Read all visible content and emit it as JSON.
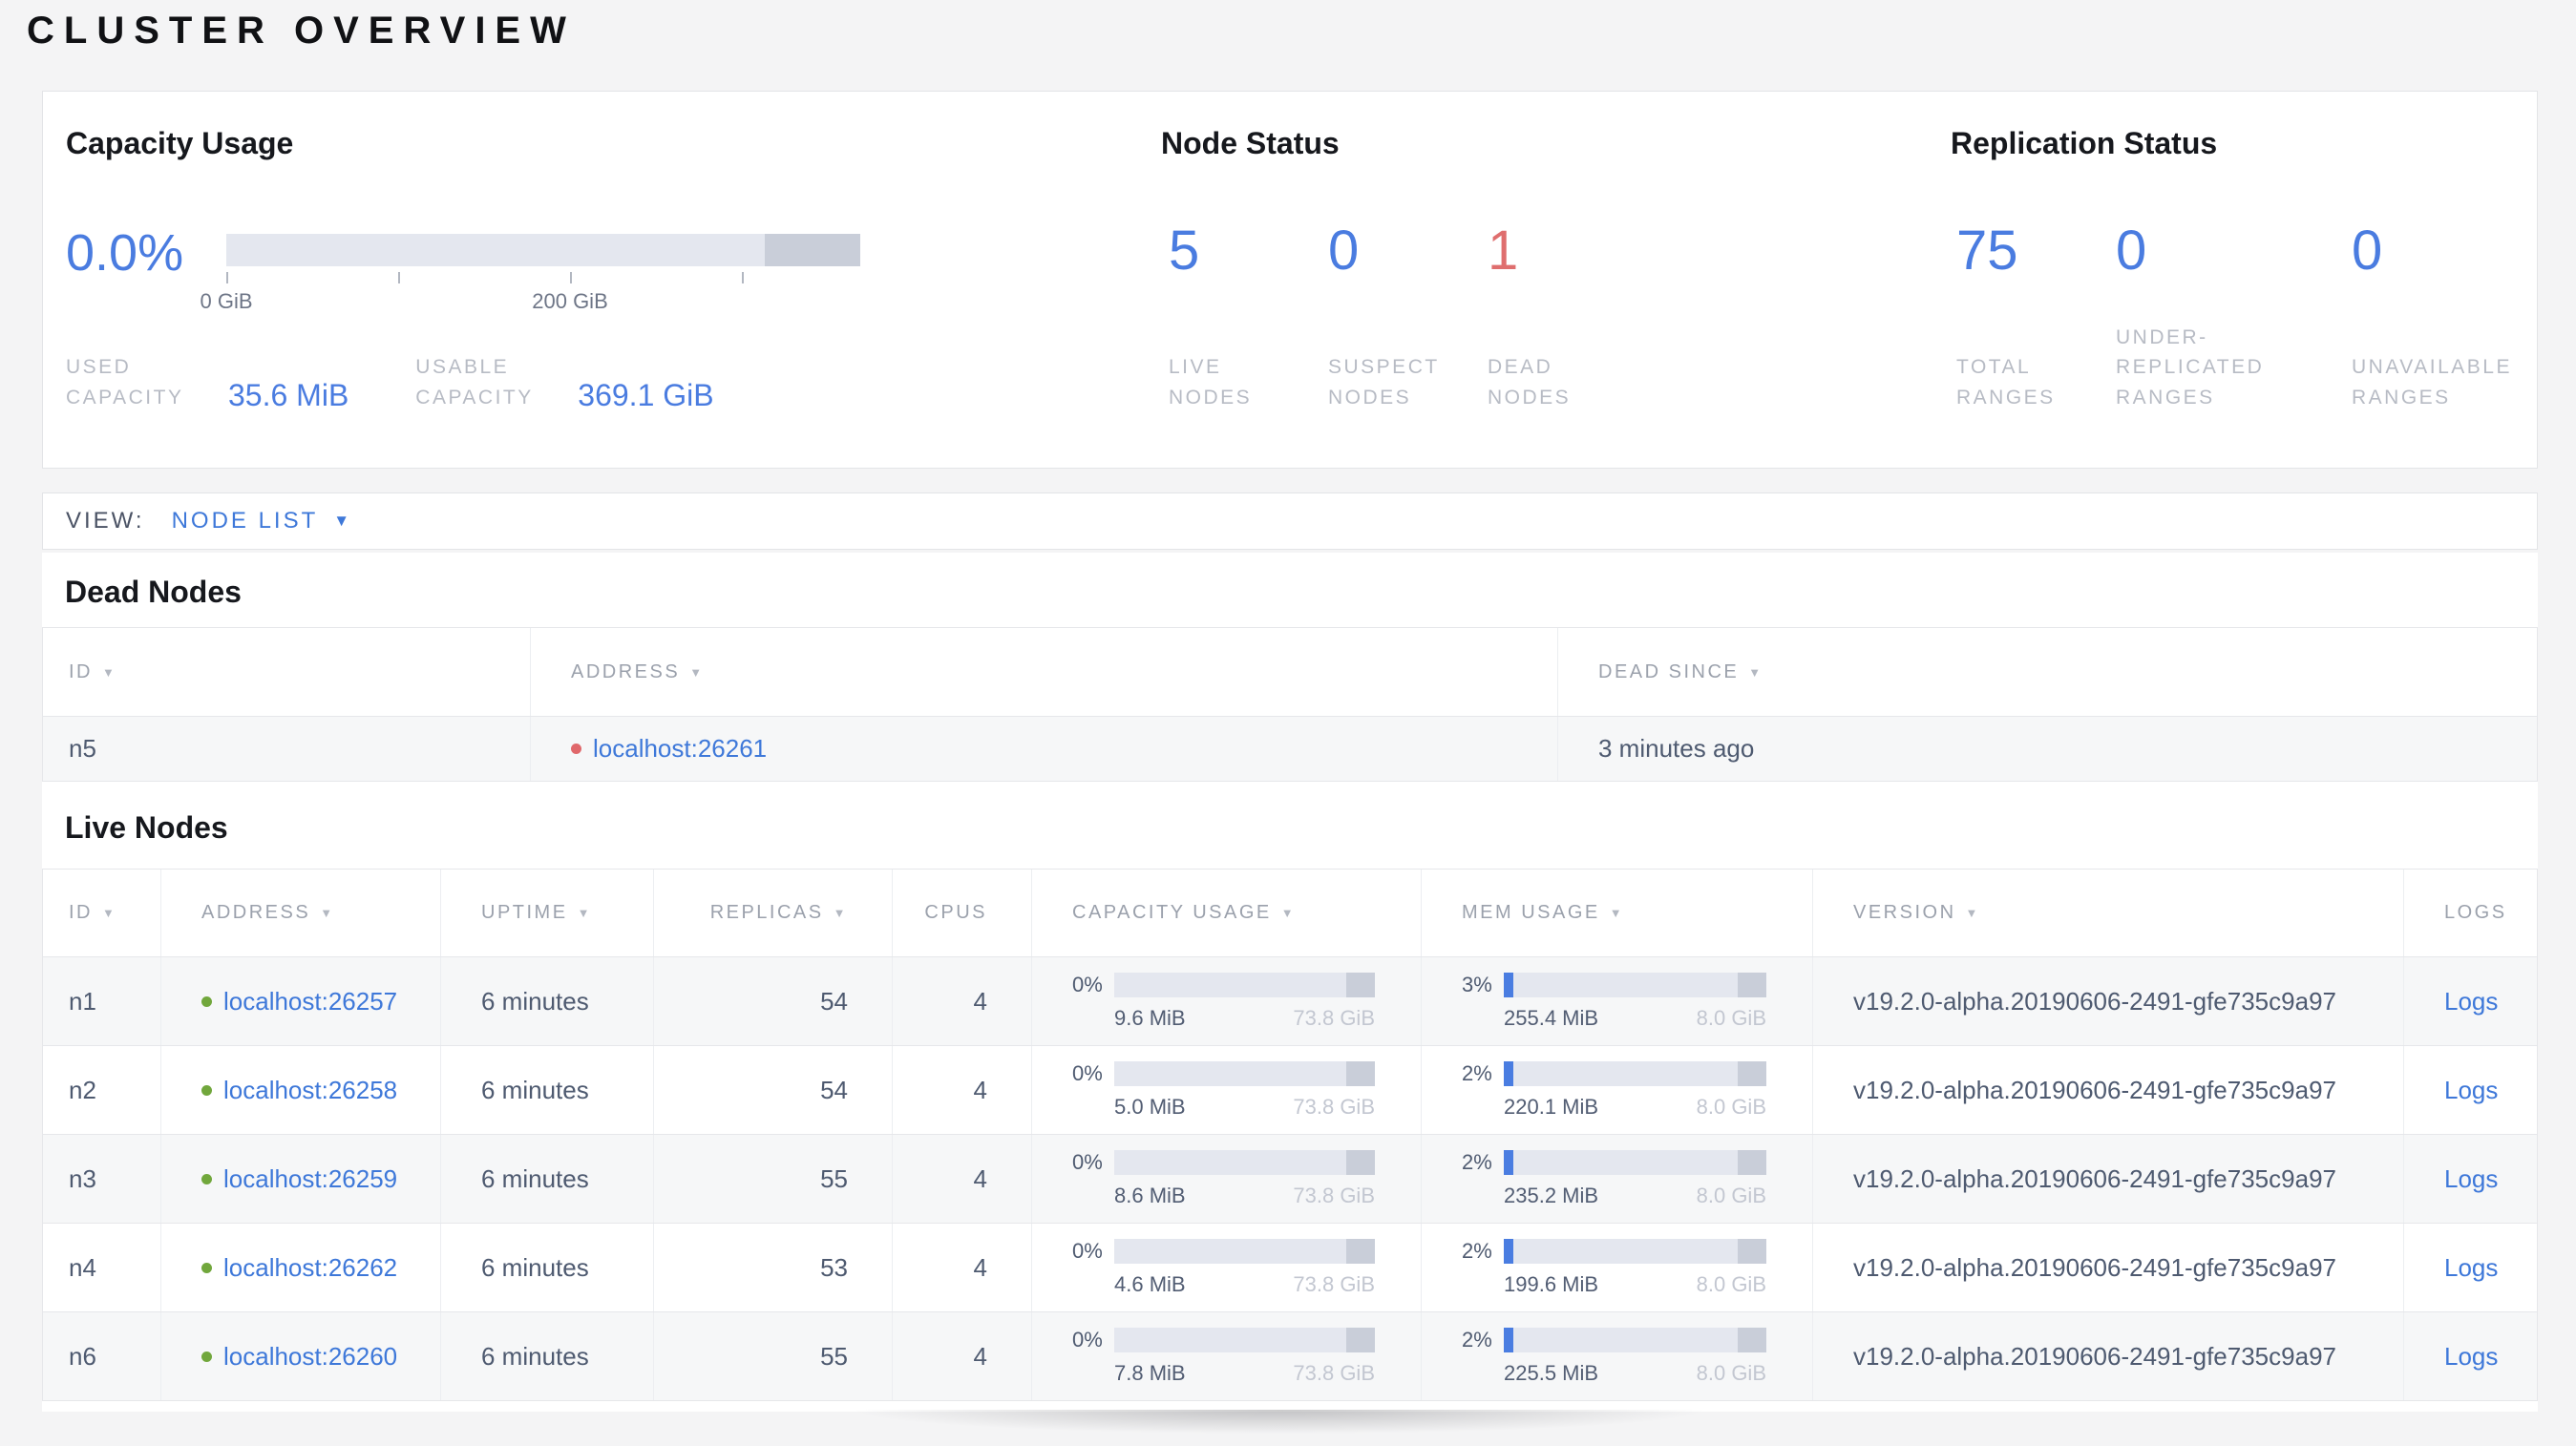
{
  "page": {
    "title": "CLUSTER OVERVIEW"
  },
  "icons": {
    "sort_arrow": "▼",
    "dropdown_caret": "▼"
  },
  "colors": {
    "accent_blue": "#4a7ce0",
    "link_blue": "#3e78d9",
    "danger_red": "#df6e6e",
    "live_dot_green": "#71a73c",
    "dead_dot_red": "#e0686b",
    "bar_light": "#e4e7ef",
    "bar_dark": "#c9ced9",
    "mem_used_blue": "#4a7de1"
  },
  "summary": {
    "capacity": {
      "title": "Capacity Usage",
      "percent": "0.0%",
      "axis_tick_labels": [
        "0 GiB",
        "200 GiB"
      ],
      "stats": [
        {
          "label": "USED CAPACITY",
          "value": "35.6 MiB"
        },
        {
          "label": "USABLE CAPACITY",
          "value": "369.1 GiB"
        }
      ]
    },
    "node_status": {
      "title": "Node Status",
      "stats": [
        {
          "value": "5",
          "label": "LIVE NODES"
        },
        {
          "value": "0",
          "label": "SUSPECT NODES"
        },
        {
          "value": "1",
          "label": "DEAD NODES"
        }
      ]
    },
    "replication": {
      "title": "Replication Status",
      "stats": [
        {
          "value": "75",
          "label": "TOTAL RANGES"
        },
        {
          "value": "0",
          "label": "UNDER-REPLICATED RANGES"
        },
        {
          "value": "0",
          "label": "UNAVAILABLE RANGES"
        }
      ]
    }
  },
  "view_bar": {
    "label": "VIEW:",
    "selected": "NODE LIST"
  },
  "dead_nodes": {
    "title": "Dead Nodes",
    "columns": [
      {
        "label": "ID"
      },
      {
        "label": "ADDRESS"
      },
      {
        "label": "DEAD SINCE"
      }
    ],
    "rows": [
      {
        "id": "n5",
        "address": "localhost:26261",
        "dead_since": "3 minutes ago"
      }
    ]
  },
  "live_nodes": {
    "title": "Live Nodes",
    "columns": [
      {
        "label": "ID"
      },
      {
        "label": "ADDRESS"
      },
      {
        "label": "UPTIME"
      },
      {
        "label": "REPLICAS"
      },
      {
        "label": "CPUS"
      },
      {
        "label": "CAPACITY USAGE"
      },
      {
        "label": "MEM USAGE"
      },
      {
        "label": "VERSION"
      },
      {
        "label": "LOGS"
      }
    ],
    "rows": [
      {
        "id": "n1",
        "address": "localhost:26257",
        "uptime": "6 minutes",
        "replicas": "54",
        "cpus": "4",
        "capacity": {
          "pct": "0%",
          "pct_num": 0,
          "used": "9.6 MiB",
          "total": "73.8 GiB"
        },
        "mem": {
          "pct": "3%",
          "pct_num": 3,
          "used": "255.4 MiB",
          "total": "8.0 GiB"
        },
        "version": "v19.2.0-alpha.20190606-2491-gfe735c9a97",
        "logs_label": "Logs"
      },
      {
        "id": "n2",
        "address": "localhost:26258",
        "uptime": "6 minutes",
        "replicas": "54",
        "cpus": "4",
        "capacity": {
          "pct": "0%",
          "pct_num": 0,
          "used": "5.0 MiB",
          "total": "73.8 GiB"
        },
        "mem": {
          "pct": "2%",
          "pct_num": 2,
          "used": "220.1 MiB",
          "total": "8.0 GiB"
        },
        "version": "v19.2.0-alpha.20190606-2491-gfe735c9a97",
        "logs_label": "Logs"
      },
      {
        "id": "n3",
        "address": "localhost:26259",
        "uptime": "6 minutes",
        "replicas": "55",
        "cpus": "4",
        "capacity": {
          "pct": "0%",
          "pct_num": 0,
          "used": "8.6 MiB",
          "total": "73.8 GiB"
        },
        "mem": {
          "pct": "2%",
          "pct_num": 2,
          "used": "235.2 MiB",
          "total": "8.0 GiB"
        },
        "version": "v19.2.0-alpha.20190606-2491-gfe735c9a97",
        "logs_label": "Logs"
      },
      {
        "id": "n4",
        "address": "localhost:26262",
        "uptime": "6 minutes",
        "replicas": "53",
        "cpus": "4",
        "capacity": {
          "pct": "0%",
          "pct_num": 0,
          "used": "4.6 MiB",
          "total": "73.8 GiB"
        },
        "mem": {
          "pct": "2%",
          "pct_num": 2,
          "used": "199.6 MiB",
          "total": "8.0 GiB"
        },
        "version": "v19.2.0-alpha.20190606-2491-gfe735c9a97",
        "logs_label": "Logs"
      },
      {
        "id": "n6",
        "address": "localhost:26260",
        "uptime": "6 minutes",
        "replicas": "55",
        "cpus": "4",
        "capacity": {
          "pct": "0%",
          "pct_num": 0,
          "used": "7.8 MiB",
          "total": "73.8 GiB"
        },
        "mem": {
          "pct": "2%",
          "pct_num": 2,
          "used": "225.5 MiB",
          "total": "8.0 GiB"
        },
        "version": "v19.2.0-alpha.20190606-2491-gfe735c9a97",
        "logs_label": "Logs"
      }
    ]
  }
}
